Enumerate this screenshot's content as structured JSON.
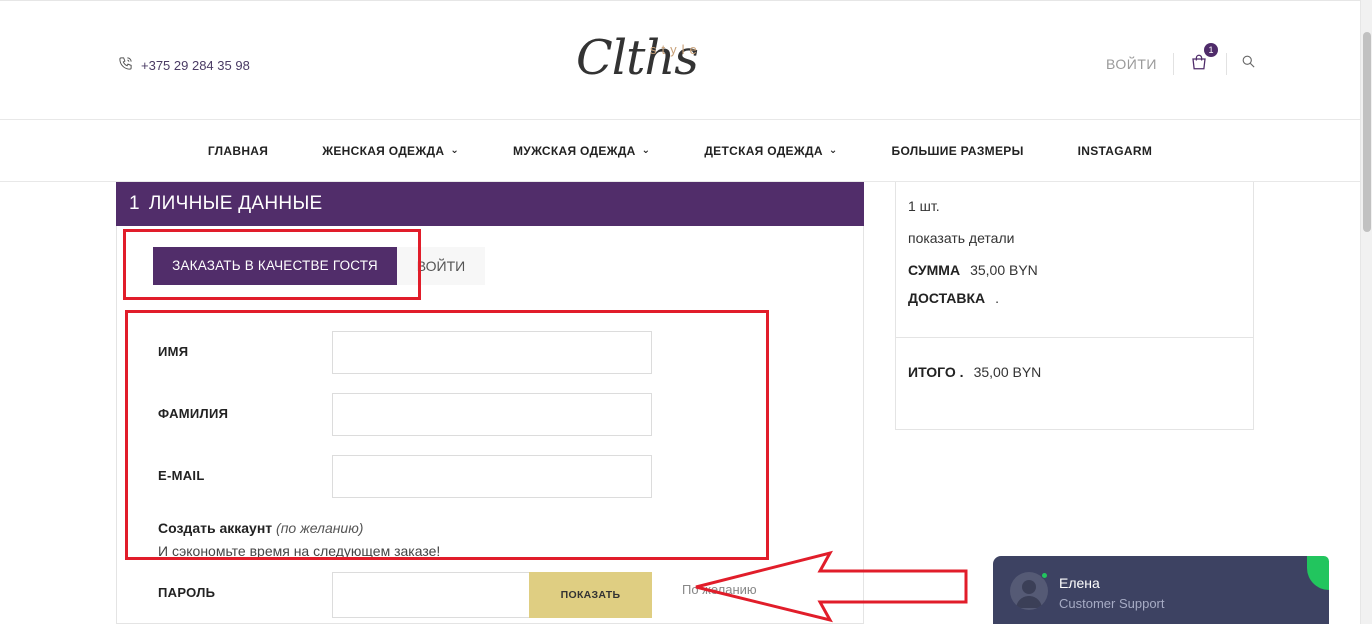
{
  "header": {
    "phone": "+375 29 284 35 98",
    "logo_main": "Clths",
    "logo_sub": "style",
    "login_label": "ВОЙТИ",
    "cart_count": "1"
  },
  "nav": {
    "items": [
      {
        "label": "ГЛАВНАЯ",
        "dropdown": false
      },
      {
        "label": "ЖЕНСКАЯ ОДЕЖДА",
        "dropdown": true
      },
      {
        "label": "МУЖСКАЯ ОДЕЖДА",
        "dropdown": true
      },
      {
        "label": "ДЕТСКАЯ ОДЕЖДА",
        "dropdown": true
      },
      {
        "label": "БОЛЬШИЕ РАЗМЕРЫ",
        "dropdown": false
      },
      {
        "label": "INSTAGARM",
        "dropdown": false
      }
    ]
  },
  "checkout": {
    "step_number": "1",
    "step_title": "ЛИЧНЫЕ ДАННЫЕ",
    "guest_button": "ЗАКАЗАТЬ В КАЧЕСТВЕ ГОСТЯ",
    "login_tab": "ВОЙТИ",
    "fields": {
      "first_name_label": "ИМЯ",
      "first_name_value": "",
      "last_name_label": "ФАМИЛИЯ",
      "last_name_value": "",
      "email_label": "E-MAIL",
      "email_value": ""
    },
    "create_account_bold": "Создать аккаунт",
    "create_account_optional": "(по желанию)",
    "save_time_text": "И сэкономьте время на следующем заказе!",
    "password_label": "ПАРОЛЬ",
    "show_button": "ПОКАЗАТЬ",
    "optional_text": "По желанию"
  },
  "summary": {
    "quantity": "1 шт.",
    "show_details": "показать детали",
    "subtotal_label": "СУММА",
    "subtotal_value": "35,00 BYN",
    "shipping_label": "ДОСТАВКА",
    "shipping_value": ".",
    "total_label": "ИТОГО .",
    "total_value": "35,00 BYN"
  },
  "chat": {
    "agent_name": "Елена",
    "agent_role": "Customer Support"
  },
  "colors": {
    "brand_purple": "#512d6a",
    "show_button_gold": "#dfce82",
    "annotation_red": "#e11d2a",
    "chat_bg": "#3d4262",
    "online_green": "#22c55e"
  }
}
